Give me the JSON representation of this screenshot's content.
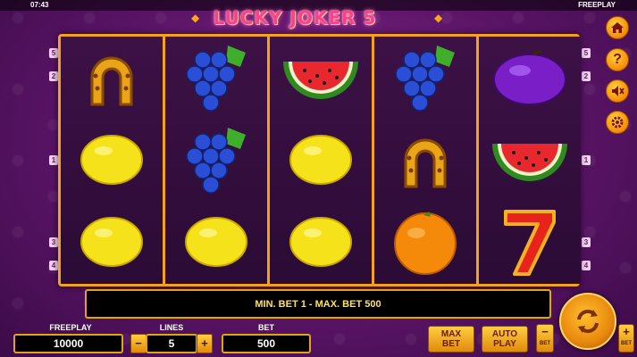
{
  "status_bar": {
    "time": "07:43",
    "mode": "FREEPLAY"
  },
  "game": {
    "title": "LUCKY JOKER 5"
  },
  "colors": {
    "frame": "#f2a21b",
    "title": "#ff3f86",
    "message_text": "#ffe066",
    "background": "#5a1466"
  },
  "reels": [
    [
      "horseshoe",
      "lemon",
      "lemon"
    ],
    [
      "grapes",
      "grapes",
      "lemon"
    ],
    [
      "watermelon",
      "lemon",
      "lemon"
    ],
    [
      "grapes",
      "horseshoe",
      "orange"
    ],
    [
      "plum",
      "watermelon",
      "seven"
    ]
  ],
  "line_markers": {
    "left": [
      "5",
      "2",
      "1",
      "3",
      "4"
    ],
    "right": [
      "5",
      "2",
      "1",
      "3",
      "4"
    ]
  },
  "side_buttons": [
    {
      "icon": "home-icon"
    },
    {
      "icon": "help-icon"
    },
    {
      "icon": "sound-off-icon"
    },
    {
      "icon": "gear-icon"
    }
  ],
  "message": "MIN. BET 1 - MAX. BET 500",
  "bottom": {
    "freeplay_label": "FREEPLAY",
    "freeplay_value": "10000",
    "lines_label": "LINES",
    "lines_value": "5",
    "lines_minus": "−",
    "lines_plus": "+",
    "bet_label": "BET",
    "bet_value": "500",
    "max_bet_line1": "MAX",
    "max_bet_line2": "BET",
    "auto_play_line1": "AUTO",
    "auto_play_line2": "PLAY",
    "bet_minus": "−",
    "bet_minus_label": "BET",
    "bet_plus": "+",
    "bet_plus_label": "BET"
  }
}
